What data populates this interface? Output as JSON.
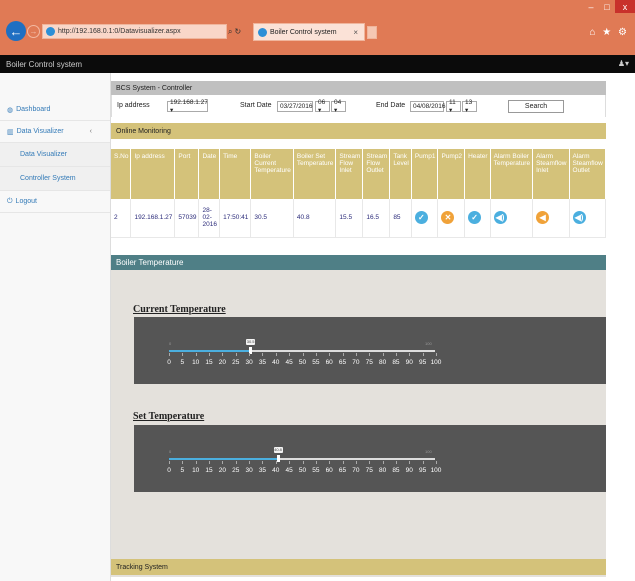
{
  "browser": {
    "url": "http://192.168.0.1:0/Datavisualizer.aspx",
    "tab_title": "Boiler Control system",
    "tab_close": "×",
    "window_buttons": [
      "–",
      "□",
      "x"
    ],
    "toolbar_icons": "⌂ ★ ⚙"
  },
  "app": {
    "title": "Boiler Control system",
    "user_icon": "♟▾"
  },
  "sidebar": {
    "items": [
      {
        "label": "Dashboard",
        "icon": "◍"
      },
      {
        "label": "Data Visualizer",
        "icon": "▥",
        "chevron": "‹"
      },
      {
        "label": "Data Visualizer"
      },
      {
        "label": "Controller System"
      },
      {
        "label": "Logout",
        "icon": "⏻"
      }
    ]
  },
  "panel": {
    "title": "BCS System - Controller"
  },
  "filters": {
    "ip_label": "Ip address",
    "ip_value": "192.168.1.27 ▾",
    "start_label": "Start Date",
    "start_date": "03/27/2016",
    "start_hour": "06 ▾",
    "start_min": "04 ▾",
    "end_label": "End Date",
    "end_date": "04/08/2016",
    "end_hour": "11 ▾",
    "end_min": "13 ▾",
    "search_label": "Search"
  },
  "online": {
    "title": "Online Monitoring"
  },
  "table": {
    "headers": [
      "S.No",
      "Ip address",
      "Port",
      "Date",
      "Time",
      "Boiler Current Temperature",
      "Boiler Set Temperature",
      "Stream Flow Inlet",
      "Stream Flow Outlet",
      "Tank Level",
      "Pump1",
      "Pump2",
      "Heater",
      "Alarm Boiler Temperature",
      "Alarm Steamflow Inlet",
      "Alarm Steamflow Outlet"
    ],
    "row": {
      "sno": "2",
      "ip": "192.168.1.27",
      "port": "57039",
      "date": "28-02-2016",
      "time": "17:50:41",
      "current_temp": "30.5",
      "set_temp": "40.8",
      "flow_in": "15.5",
      "flow_out": "16.5",
      "tank": "85",
      "pump1": "✓",
      "pump2": "✕",
      "heater": "✓",
      "alarm_boiler": "◀)",
      "alarm_in": "◀",
      "alarm_out": "◀)"
    },
    "status_colors": {
      "ok": "#4bafdf",
      "off": "#f0a239"
    }
  },
  "boiler": {
    "title": "Boiler Temperature",
    "current_title": "Current Temperature",
    "set_title": "Set Temperature",
    "scale_min": "0",
    "scale_max": "100",
    "scale_labels": [
      "0",
      "5",
      "10",
      "15",
      "20",
      "25",
      "30",
      "35",
      "40",
      "45",
      "50",
      "55",
      "60",
      "65",
      "70",
      "75",
      "80",
      "85",
      "90",
      "95",
      "100"
    ],
    "current_value": 30.5,
    "set_value": 40.8,
    "current_bubble": "30.5",
    "set_bubble": "40.8"
  },
  "tracking": {
    "title": "Tracking System"
  }
}
